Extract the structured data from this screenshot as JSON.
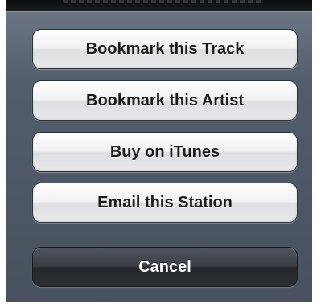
{
  "action_sheet": {
    "buttons": [
      {
        "label": "Bookmark this Track"
      },
      {
        "label": "Bookmark this Artist"
      },
      {
        "label": "Buy on iTunes"
      },
      {
        "label": "Email this Station"
      }
    ],
    "cancel_label": "Cancel"
  },
  "colors": {
    "sheet_background": "#4f5a68",
    "button_light": "#f1f1f2",
    "button_dark": "#2c2f35",
    "text_dark": "#1b1b1c",
    "text_light": "#ffffff"
  }
}
